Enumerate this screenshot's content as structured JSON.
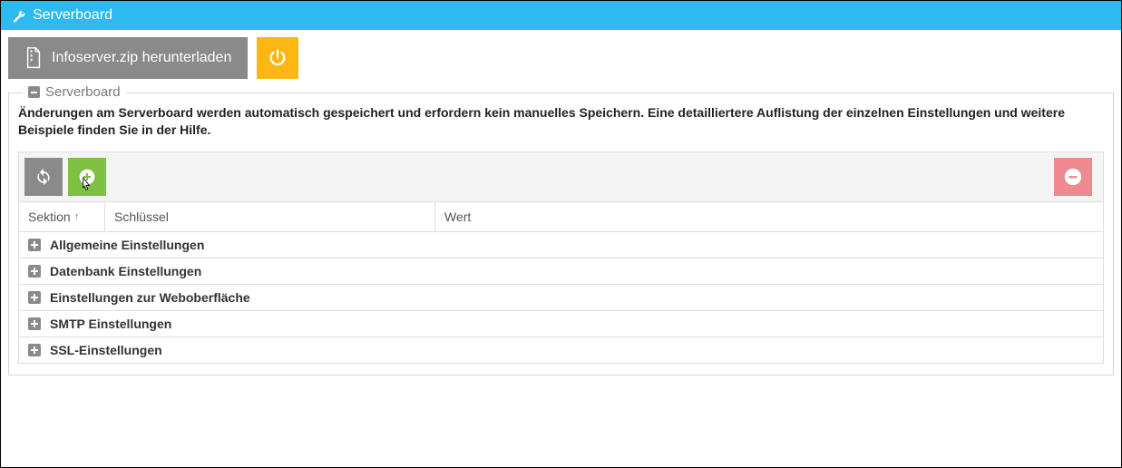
{
  "header": {
    "title": "Serverboard"
  },
  "toolbar": {
    "download_label": "Infoserver.zip herunterladen"
  },
  "fieldset": {
    "legend": "Serverboard",
    "info_text": "Änderungen am Serverboard werden automatisch gespeichert und erfordern kein manuelles Speichern. Eine detailliertere Auflistung der einzelnen Einstellungen und weitere Beispiele finden Sie in der Hilfe."
  },
  "grid": {
    "columns": {
      "sektion": "Sektion",
      "schluessel": "Schlüssel",
      "wert": "Wert"
    },
    "sort_column": "sektion",
    "sort_dir": "asc",
    "groups": [
      {
        "label": "Allgemeine Einstellungen"
      },
      {
        "label": "Datenbank Einstellungen"
      },
      {
        "label": "Einstellungen zur Weboberfläche"
      },
      {
        "label": "SMTP Einstellungen"
      },
      {
        "label": "SSL-Einstellungen"
      }
    ]
  }
}
